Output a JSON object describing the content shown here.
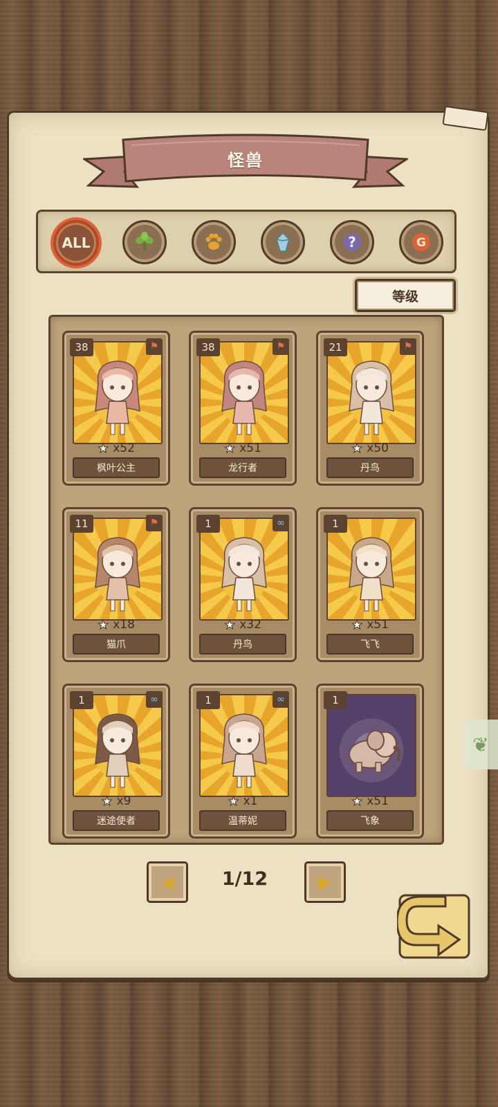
{
  "title": "怪兽",
  "filters": [
    {
      "label": "ALL",
      "icon": "all-icon",
      "active": true
    },
    {
      "label": "",
      "icon": "leaf-icon",
      "active": false
    },
    {
      "label": "",
      "icon": "paw-icon",
      "active": false
    },
    {
      "label": "",
      "icon": "crystal-icon",
      "active": false
    },
    {
      "label": "",
      "icon": "question-icon",
      "active": false
    },
    {
      "label": "",
      "icon": "g-coin-icon",
      "active": false
    }
  ],
  "sort_label": "等级",
  "cards": [
    {
      "level": "38",
      "count": "x52",
      "name": "枫叶公主",
      "tag": "flag",
      "bg": "sun"
    },
    {
      "level": "38",
      "count": "x51",
      "name": "龙行者",
      "tag": "flag",
      "bg": "sun"
    },
    {
      "level": "21",
      "count": "x50",
      "name": "丹鸟",
      "tag": "flag",
      "bg": "sun"
    },
    {
      "level": "11",
      "count": "x18",
      "name": "猫爪",
      "tag": "flag",
      "bg": "sun"
    },
    {
      "level": "1",
      "count": "x32",
      "name": "丹鸟",
      "tag": "link",
      "bg": "sun"
    },
    {
      "level": "1",
      "count": "x51",
      "name": "飞飞",
      "tag": "none",
      "bg": "sun"
    },
    {
      "level": "1",
      "count": "x9",
      "name": "迷途使者",
      "tag": "link",
      "bg": "sun"
    },
    {
      "level": "1",
      "count": "x1",
      "name": "温蒂妮",
      "tag": "link",
      "bg": "sun"
    },
    {
      "level": "1",
      "count": "x51",
      "name": "飞象",
      "tag": "none",
      "bg": "purple"
    }
  ],
  "pager": {
    "label": "1/12"
  },
  "colors": {
    "accent": "#d9643a",
    "card_gold": "#f2c245",
    "wood": "#6b5038"
  }
}
